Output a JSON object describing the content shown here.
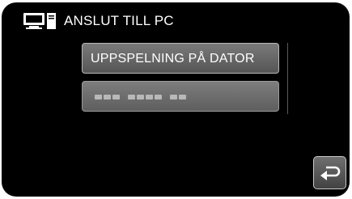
{
  "header": {
    "title": "ANSLUT TILL PC",
    "icon": "computer-connection-icon"
  },
  "menu": {
    "items": [
      {
        "label": "UPPSPELNING PÅ DATOR",
        "state": "enabled"
      },
      {
        "label": "",
        "state": "disabled",
        "obscured": true
      }
    ]
  },
  "controls": {
    "back_icon": "return-icon"
  },
  "colors": {
    "background": "#000000",
    "button_top": "#7a7a7a",
    "button_bottom": "#555555",
    "text": "#ffffff"
  }
}
